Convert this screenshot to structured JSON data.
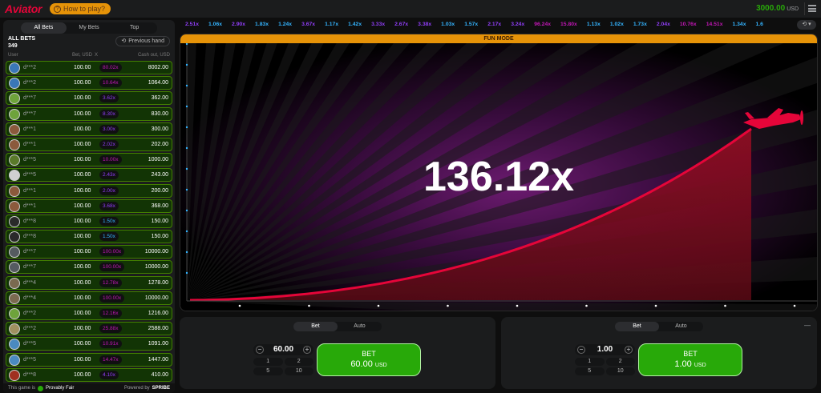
{
  "header": {
    "logo": "Aviator",
    "how_to_play": "How to play?",
    "balance": "3000.00",
    "currency": "USD"
  },
  "bets_panel": {
    "tabs": [
      "All Bets",
      "My Bets",
      "Top"
    ],
    "all_bets_label": "ALL BETS",
    "all_bets_count": "349",
    "previous_hand": "Previous hand",
    "columns": {
      "user": "User",
      "bet": "Bet, USD",
      "x": "X",
      "cashout": "Cash out, USD"
    },
    "rows": [
      {
        "user": "d***2",
        "bet": "100.00",
        "mult": "80.02x",
        "cash": "8002.00",
        "color": "#c017b4",
        "avatar": "#3a77b8"
      },
      {
        "user": "d***2",
        "bet": "100.00",
        "mult": "10.64x",
        "cash": "1064.00",
        "color": "#c017b4",
        "avatar": "#3a77b8"
      },
      {
        "user": "d***7",
        "bet": "100.00",
        "mult": "3.62x",
        "cash": "362.00",
        "color": "#913ef8",
        "avatar": "#6ea33b"
      },
      {
        "user": "d***7",
        "bet": "100.00",
        "mult": "8.30x",
        "cash": "830.00",
        "color": "#913ef8",
        "avatar": "#6ea33b"
      },
      {
        "user": "d***1",
        "bet": "100.00",
        "mult": "3.00x",
        "cash": "300.00",
        "color": "#913ef8",
        "avatar": "#8b5a3c"
      },
      {
        "user": "d***1",
        "bet": "100.00",
        "mult": "2.02x",
        "cash": "202.00",
        "color": "#913ef8",
        "avatar": "#8b5a3c"
      },
      {
        "user": "d***5",
        "bet": "100.00",
        "mult": "10.00x",
        "cash": "1000.00",
        "color": "#c017b4",
        "avatar": "#5a7a2a"
      },
      {
        "user": "d***5",
        "bet": "100.00",
        "mult": "2.43x",
        "cash": "243.00",
        "color": "#913ef8",
        "avatar": "#d0d0d0"
      },
      {
        "user": "d***1",
        "bet": "100.00",
        "mult": "2.00x",
        "cash": "200.00",
        "color": "#913ef8",
        "avatar": "#8b5a3c"
      },
      {
        "user": "d***1",
        "bet": "100.00",
        "mult": "3.68x",
        "cash": "368.00",
        "color": "#913ef8",
        "avatar": "#8b5a3c"
      },
      {
        "user": "d***8",
        "bet": "100.00",
        "mult": "1.50x",
        "cash": "150.00",
        "color": "#34b4ff",
        "avatar": "#2a2a2a"
      },
      {
        "user": "d***8",
        "bet": "100.00",
        "mult": "1.50x",
        "cash": "150.00",
        "color": "#34b4ff",
        "avatar": "#2a2a2a"
      },
      {
        "user": "d***7",
        "bet": "100.00",
        "mult": "100.00x",
        "cash": "10000.00",
        "color": "#c017b4",
        "avatar": "#555b60"
      },
      {
        "user": "d***7",
        "bet": "100.00",
        "mult": "100.00x",
        "cash": "10000.00",
        "color": "#c017b4",
        "avatar": "#555b60"
      },
      {
        "user": "d***4",
        "bet": "100.00",
        "mult": "12.78x",
        "cash": "1278.00",
        "color": "#c017b4",
        "avatar": "#7a6a50"
      },
      {
        "user": "d***4",
        "bet": "100.00",
        "mult": "100.00x",
        "cash": "10000.00",
        "color": "#c017b4",
        "avatar": "#7a6a50"
      },
      {
        "user": "d***2",
        "bet": "100.00",
        "mult": "12.16x",
        "cash": "1216.00",
        "color": "#c017b4",
        "avatar": "#6ea33b"
      },
      {
        "user": "d***2",
        "bet": "100.00",
        "mult": "25.88x",
        "cash": "2588.00",
        "color": "#c017b4",
        "avatar": "#a09060"
      },
      {
        "user": "d***5",
        "bet": "100.00",
        "mult": "10.91x",
        "cash": "1091.00",
        "color": "#c017b4",
        "avatar": "#4a8ac0"
      },
      {
        "user": "d***5",
        "bet": "100.00",
        "mult": "14.47x",
        "cash": "1447.00",
        "color": "#c017b4",
        "avatar": "#4a8ac0"
      },
      {
        "user": "d***8",
        "bet": "100.00",
        "mult": "4.10x",
        "cash": "410.00",
        "color": "#913ef8",
        "avatar": "#a03020"
      }
    ],
    "footer": {
      "fair_prefix": "This game is",
      "fair": "Provably Fair",
      "powered": "Powered by",
      "brand": "SPRIBE"
    }
  },
  "history": [
    {
      "v": "2.51x",
      "c": "#913ef8"
    },
    {
      "v": "1.06x",
      "c": "#34b4ff"
    },
    {
      "v": "2.90x",
      "c": "#913ef8"
    },
    {
      "v": "1.83x",
      "c": "#34b4ff"
    },
    {
      "v": "1.24x",
      "c": "#34b4ff"
    },
    {
      "v": "3.67x",
      "c": "#913ef8"
    },
    {
      "v": "1.17x",
      "c": "#34b4ff"
    },
    {
      "v": "1.42x",
      "c": "#34b4ff"
    },
    {
      "v": "3.33x",
      "c": "#913ef8"
    },
    {
      "v": "2.67x",
      "c": "#913ef8"
    },
    {
      "v": "3.38x",
      "c": "#913ef8"
    },
    {
      "v": "1.03x",
      "c": "#34b4ff"
    },
    {
      "v": "1.57x",
      "c": "#34b4ff"
    },
    {
      "v": "2.17x",
      "c": "#913ef8"
    },
    {
      "v": "3.24x",
      "c": "#913ef8"
    },
    {
      "v": "96.24x",
      "c": "#c017b4"
    },
    {
      "v": "15.80x",
      "c": "#c017b4"
    },
    {
      "v": "1.13x",
      "c": "#34b4ff"
    },
    {
      "v": "1.02x",
      "c": "#34b4ff"
    },
    {
      "v": "1.73x",
      "c": "#34b4ff"
    },
    {
      "v": "2.04x",
      "c": "#913ef8"
    },
    {
      "v": "10.76x",
      "c": "#c017b4"
    },
    {
      "v": "14.51x",
      "c": "#c017b4"
    },
    {
      "v": "1.34x",
      "c": "#34b4ff"
    },
    {
      "v": "1.6",
      "c": "#34b4ff"
    }
  ],
  "game": {
    "fun_mode": "FUN MODE",
    "multiplier": "136.12x"
  },
  "bet_panels": [
    {
      "tabs": [
        "Bet",
        "Auto"
      ],
      "amount": "60.00",
      "quick": [
        "1",
        "2",
        "5",
        "10"
      ],
      "bet_label": "BET",
      "bet_amount": "60.00",
      "currency": "USD"
    },
    {
      "tabs": [
        "Bet",
        "Auto"
      ],
      "amount": "1.00",
      "quick": [
        "1",
        "2",
        "5",
        "10"
      ],
      "bet_label": "BET",
      "bet_amount": "1.00",
      "currency": "USD"
    }
  ]
}
